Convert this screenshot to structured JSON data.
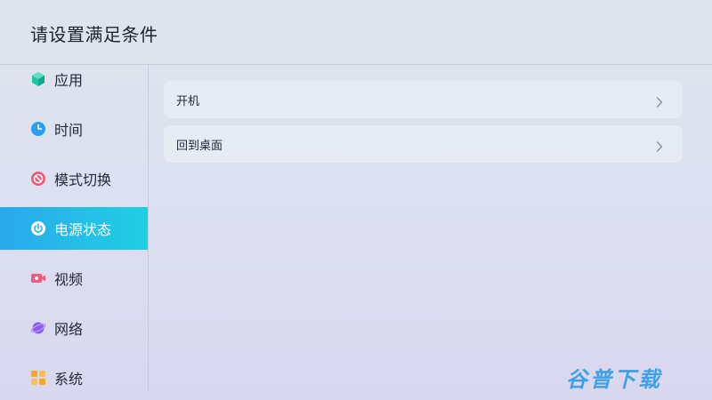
{
  "page": {
    "title": "请设置满足条件"
  },
  "sidebar": {
    "items": [
      {
        "label": "应用",
        "icon": "app-cube-icon",
        "color": "#1fc6a8",
        "active": false
      },
      {
        "label": "时间",
        "icon": "clock-icon",
        "color": "#2b9ef0",
        "active": false
      },
      {
        "label": "模式切换",
        "icon": "mode-switch-icon",
        "color": "#ef5a7a",
        "active": false
      },
      {
        "label": "电源状态",
        "icon": "power-icon",
        "color": "#ffffff",
        "active": true
      },
      {
        "label": "视频",
        "icon": "video-icon",
        "color": "#f05a7e",
        "active": false
      },
      {
        "label": "网络",
        "icon": "planet-icon",
        "color": "#8a5cf0",
        "active": false
      },
      {
        "label": "系统",
        "icon": "system-grid-icon",
        "color": "#f5a623",
        "active": false
      }
    ]
  },
  "main": {
    "options": [
      {
        "label": "开机"
      },
      {
        "label": "回到桌面"
      }
    ]
  },
  "watermark": {
    "text": "谷普下载"
  },
  "colors": {
    "accent_start": "#2aa8ec",
    "accent_end": "#1fd0e3"
  }
}
